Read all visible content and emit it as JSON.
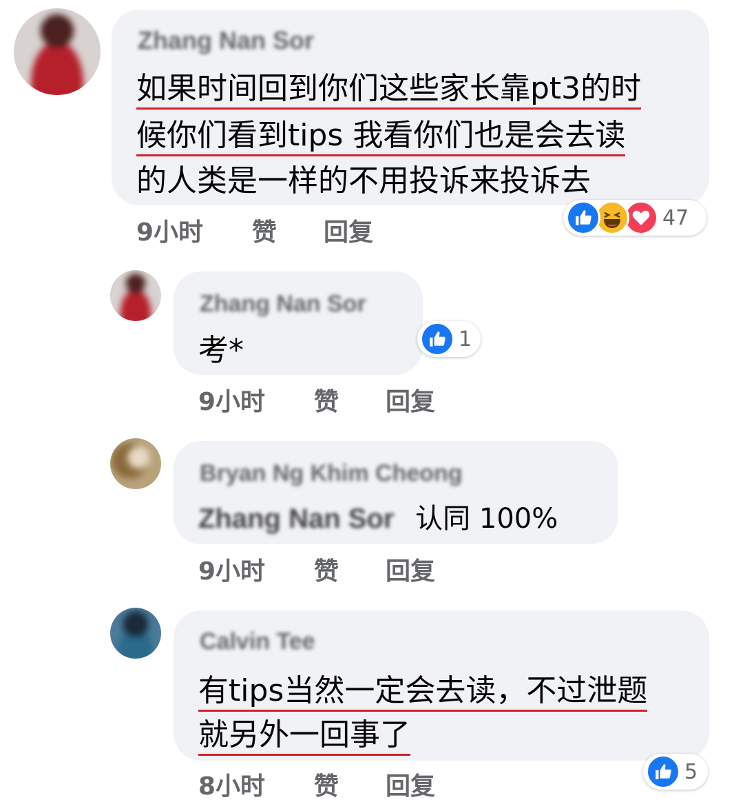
{
  "comments": [
    {
      "author": "Zhang Nan Sor",
      "lines": [
        "如果时间回到你们这些家长靠pt3的时",
        "候你们看到tips 我看你们也是会去读",
        "的人类是一样的不用投诉来投诉去"
      ],
      "time": "9小时",
      "like": "赞",
      "reply": "回复",
      "reactions": [
        "like",
        "haha",
        "love"
      ],
      "reaction_count": "47"
    },
    {
      "author": "Zhang Nan Sor",
      "lines": [
        "考*"
      ],
      "time": "9小时",
      "like": "赞",
      "reply": "回复",
      "reactions": [
        "like"
      ],
      "reaction_count": "1"
    },
    {
      "author": "Bryan Ng Khim Cheong",
      "mention": "Zhang Nan Sor",
      "lines": [
        "认同 100%"
      ],
      "time": "9小时",
      "like": "赞",
      "reply": "回复"
    },
    {
      "author": "Calvin Tee",
      "lines": [
        "有tips当然一定会去读，不过泄题",
        "就另外一回事了"
      ],
      "time": "8小时",
      "like": "赞",
      "reply": "回复",
      "reactions": [
        "like"
      ],
      "reaction_count": "5"
    }
  ],
  "colors": {
    "bubble": "#f0f2f5",
    "meta_text": "#65676b",
    "underline": "#d3202a",
    "like_blue": "#1877f2",
    "love_red": "#f33e58",
    "haha_yellow": "#f7b928"
  }
}
